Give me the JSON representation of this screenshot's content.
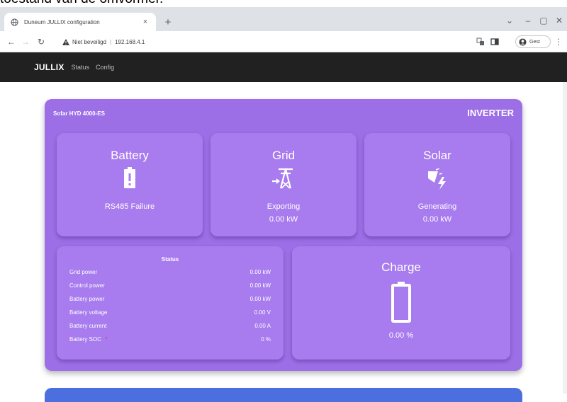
{
  "caption_strip": {
    "text": "toestand van de omvormer."
  },
  "browser": {
    "tab_title": "Duneum JULLIX configuration",
    "tab_close": "×",
    "new_tab": "+",
    "security_label": "Niet beveiligd",
    "url": "192.168.4.1",
    "profile_label": "Gest"
  },
  "app": {
    "brand": "JULLIX",
    "nav": [
      {
        "label": "Status"
      },
      {
        "label": "Config"
      }
    ]
  },
  "inverter": {
    "model": "Sofar HYD 4000-ES",
    "label": "INVERTER",
    "colors": {
      "panel": "#9c6fe6",
      "card": "#a87bee"
    },
    "battery": {
      "title": "Battery",
      "icon": "battery-alert-icon",
      "status": "RS485 Failure"
    },
    "grid": {
      "title": "Grid",
      "icon": "transmission-tower-export-icon",
      "status": "Exporting",
      "value": "0.00 kW"
    },
    "solar": {
      "title": "Solar",
      "icon": "solar-power-icon",
      "status": "Generating",
      "value": "0.00 kW"
    },
    "status": {
      "title": "Status",
      "rows": [
        {
          "label": "Grid power",
          "value": "0.00 kW"
        },
        {
          "label": "Control power",
          "value": "0.00 kW"
        },
        {
          "label": "Battery power",
          "value": "0.00 kW"
        },
        {
          "label": "Battery voltage",
          "value": "0.00 V"
        },
        {
          "label": "Battery current",
          "value": "0.00 A"
        },
        {
          "label": "Battery SOC",
          "value": "0 %",
          "flag": "•"
        }
      ]
    },
    "charge": {
      "title": "Charge",
      "icon": "battery-empty-icon",
      "value": "0.00 %"
    }
  }
}
